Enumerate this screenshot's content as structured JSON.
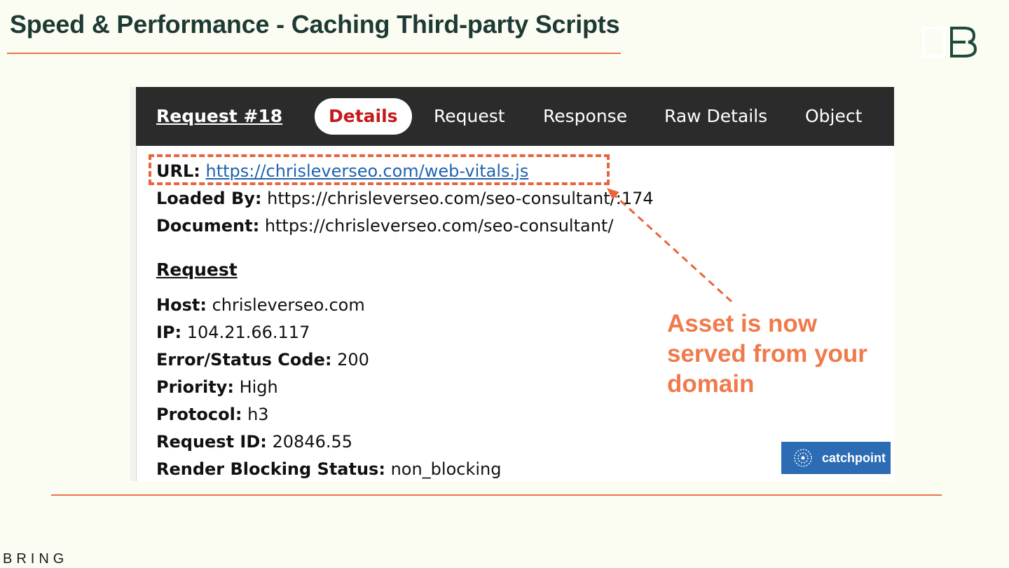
{
  "slide": {
    "title": "Speed & Performance - Caching Third-party Scripts",
    "brand_word": "BRING",
    "logo_text": "B"
  },
  "tabs": {
    "request_number": "Request #18",
    "items": [
      "Details",
      "Request",
      "Response",
      "Raw Details",
      "Object"
    ],
    "active": "Details"
  },
  "details": {
    "url_label": "URL:",
    "url_value": "https://chrisleverseo.com/web-vitals.js",
    "loaded_by_label": "Loaded By:",
    "loaded_by_value": "https://chrisleverseo.com/seo-consultant/:174",
    "document_label": "Document:",
    "document_value": "https://chrisleverseo.com/seo-consultant/"
  },
  "request_section": {
    "heading": "Request",
    "fields": [
      {
        "label": "Host:",
        "value": "chrisleverseo.com"
      },
      {
        "label": "IP:",
        "value": "104.21.66.117"
      },
      {
        "label": "Error/Status Code:",
        "value": "200"
      },
      {
        "label": "Priority:",
        "value": "High"
      },
      {
        "label": "Protocol:",
        "value": "h3"
      },
      {
        "label": "Request ID:",
        "value": "20846.55"
      },
      {
        "label": "Render Blocking Status:",
        "value": "non_blocking"
      }
    ]
  },
  "callout": {
    "line1": "Asset is now",
    "line2": "served from your",
    "line3": "domain"
  },
  "badge": {
    "label": "catchpoint"
  },
  "colors": {
    "accent": "#e8744a",
    "title": "#1e3a34",
    "tab_bar": "#2b2b2b",
    "active_tab_text": "#c41a1a",
    "link": "#1f63b0",
    "badge_bg": "#2b6cb4",
    "background": "#fbfcf2"
  }
}
